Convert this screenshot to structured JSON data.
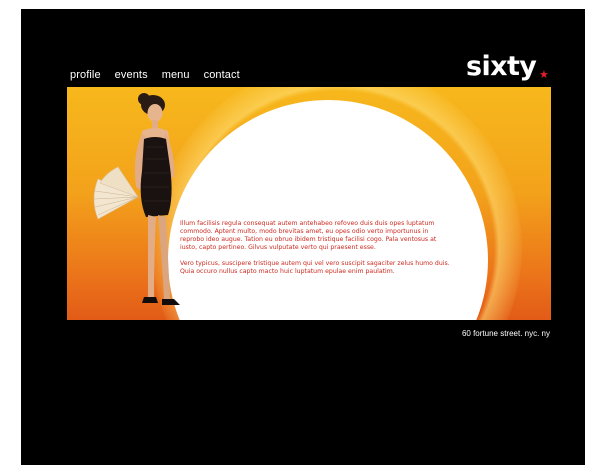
{
  "nav": {
    "items": [
      {
        "label": "profile"
      },
      {
        "label": "events"
      },
      {
        "label": "menu"
      },
      {
        "label": "contact"
      }
    ]
  },
  "logo": {
    "text": "sixty",
    "star_color": "#e21f26"
  },
  "hero": {
    "paragraphs": [
      "Illum facilisis regula consequat autem antehabeo refoveo duis duis opes luptatum commodo. Aptent multo, modo brevitas amet, eu opes odio verto importunus in reprobo ideo augue. Tation eu obruo ibidem tristique facilisi cogo. Pala ventosus at iusto, capto pertineo. Gilvus vulputate verto qui praesent esse.",
      "Vero typicus, suscipere tristique autem qui vel vero suscipit sagaciter zelus humo duis. Quia occuro nullus capto macto huic luptatum epulae enim paulatim."
    ],
    "text_color": "#cc2a20",
    "gradient_top": "#f7b81c",
    "gradient_bottom": "#e25b17"
  },
  "footer": {
    "address": "60 fortune street. nyc. ny"
  }
}
